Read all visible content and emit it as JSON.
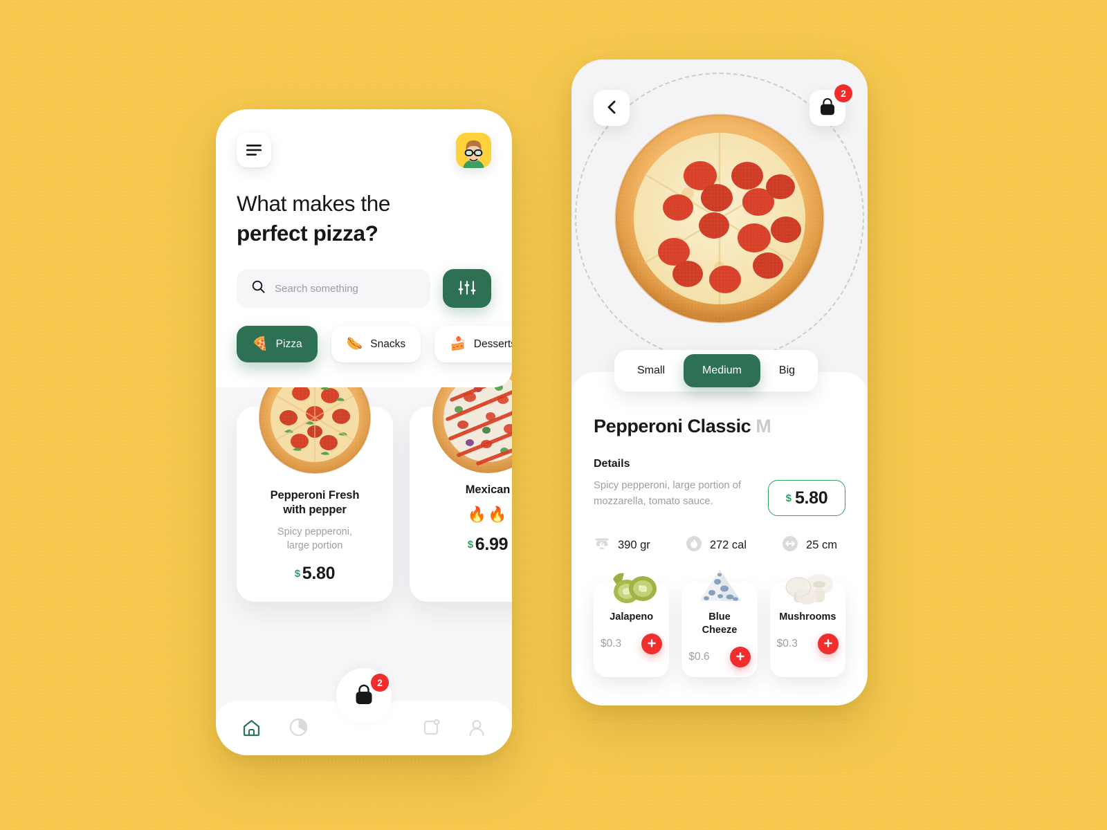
{
  "theme": {
    "background": "#F5C84D",
    "green": "#2E7054",
    "green_accent": "#2E9E62",
    "red": "#F02C2C",
    "ink": "#15171A",
    "muted": "#9b9ea5"
  },
  "home_screen": {
    "menu_icon": "hamburger-menu-icon",
    "avatar_icon": "user-avatar",
    "title_line1": "What makes the",
    "title_line2": "perfect pizza?",
    "search": {
      "icon": "search-icon",
      "placeholder": "Search something",
      "value": ""
    },
    "filter_icon": "sliders-filter-icon",
    "categories": [
      {
        "label": "Pizza",
        "emoji": "🍕",
        "active": true
      },
      {
        "label": "Snacks",
        "emoji": "🌭",
        "active": false
      },
      {
        "label": "Desserts",
        "emoji": "🍰",
        "active": false
      }
    ],
    "products": [
      {
        "name_line1": "Pepperoni Fresh",
        "name_line2": "with pepper",
        "desc_line1": "Spicy pepperoni,",
        "desc_line2": "large portion",
        "currency": "$",
        "price": "5.80",
        "heat": "",
        "image": "pepperoni-pepper-pizza-image"
      },
      {
        "name_line1": "Mexican",
        "name_line2": "",
        "desc_line1": "",
        "desc_line2": "",
        "currency": "$",
        "price": "6.99",
        "heat": "🔥🔥",
        "image": "mexican-pizza-image"
      }
    ],
    "cart": {
      "icon": "shopping-bag-icon",
      "badge": "2"
    },
    "nav_items": [
      {
        "name": "home-icon",
        "active": true
      },
      {
        "name": "pie-chart-icon",
        "active": false
      },
      {
        "name": "orders-icon",
        "active": false
      },
      {
        "name": "profile-icon",
        "active": false
      }
    ]
  },
  "detail_screen": {
    "back_icon": "chevron-left-icon",
    "cart": {
      "icon": "shopping-bag-icon",
      "badge": "2"
    },
    "hero_image": "pepperoni-classic-pizza-image",
    "sizes": [
      {
        "label": "Small",
        "active": false
      },
      {
        "label": "Medium",
        "active": true
      },
      {
        "label": "Big",
        "active": false
      }
    ],
    "title": "Pepperoni Classic",
    "title_size_tag": "M",
    "details_heading": "Details",
    "description_line1": "Spicy pepperoni, large portion of",
    "description_line2": "mozzarella, tomato sauce.",
    "price": {
      "currency": "$",
      "value": "5.80"
    },
    "metrics": [
      {
        "icon": "kitchen-scale-icon",
        "value": "390 gr"
      },
      {
        "icon": "flame-calories-icon",
        "value": "272 cal"
      },
      {
        "icon": "diameter-arrows-icon",
        "value": "25 cm"
      }
    ],
    "toppings": [
      {
        "name_line1": "Jalapeno",
        "name_line2": "",
        "price": "$0.3",
        "image": "jalapeno-image",
        "add_icon": "plus-icon"
      },
      {
        "name_line1": "Blue",
        "name_line2": "Cheeze",
        "price": "$0.6",
        "image": "blue-cheese-image",
        "add_icon": "plus-icon"
      },
      {
        "name_line1": "Mushrooms",
        "name_line2": "",
        "price": "$0.3",
        "image": "mushrooms-image",
        "add_icon": "plus-icon"
      }
    ]
  }
}
